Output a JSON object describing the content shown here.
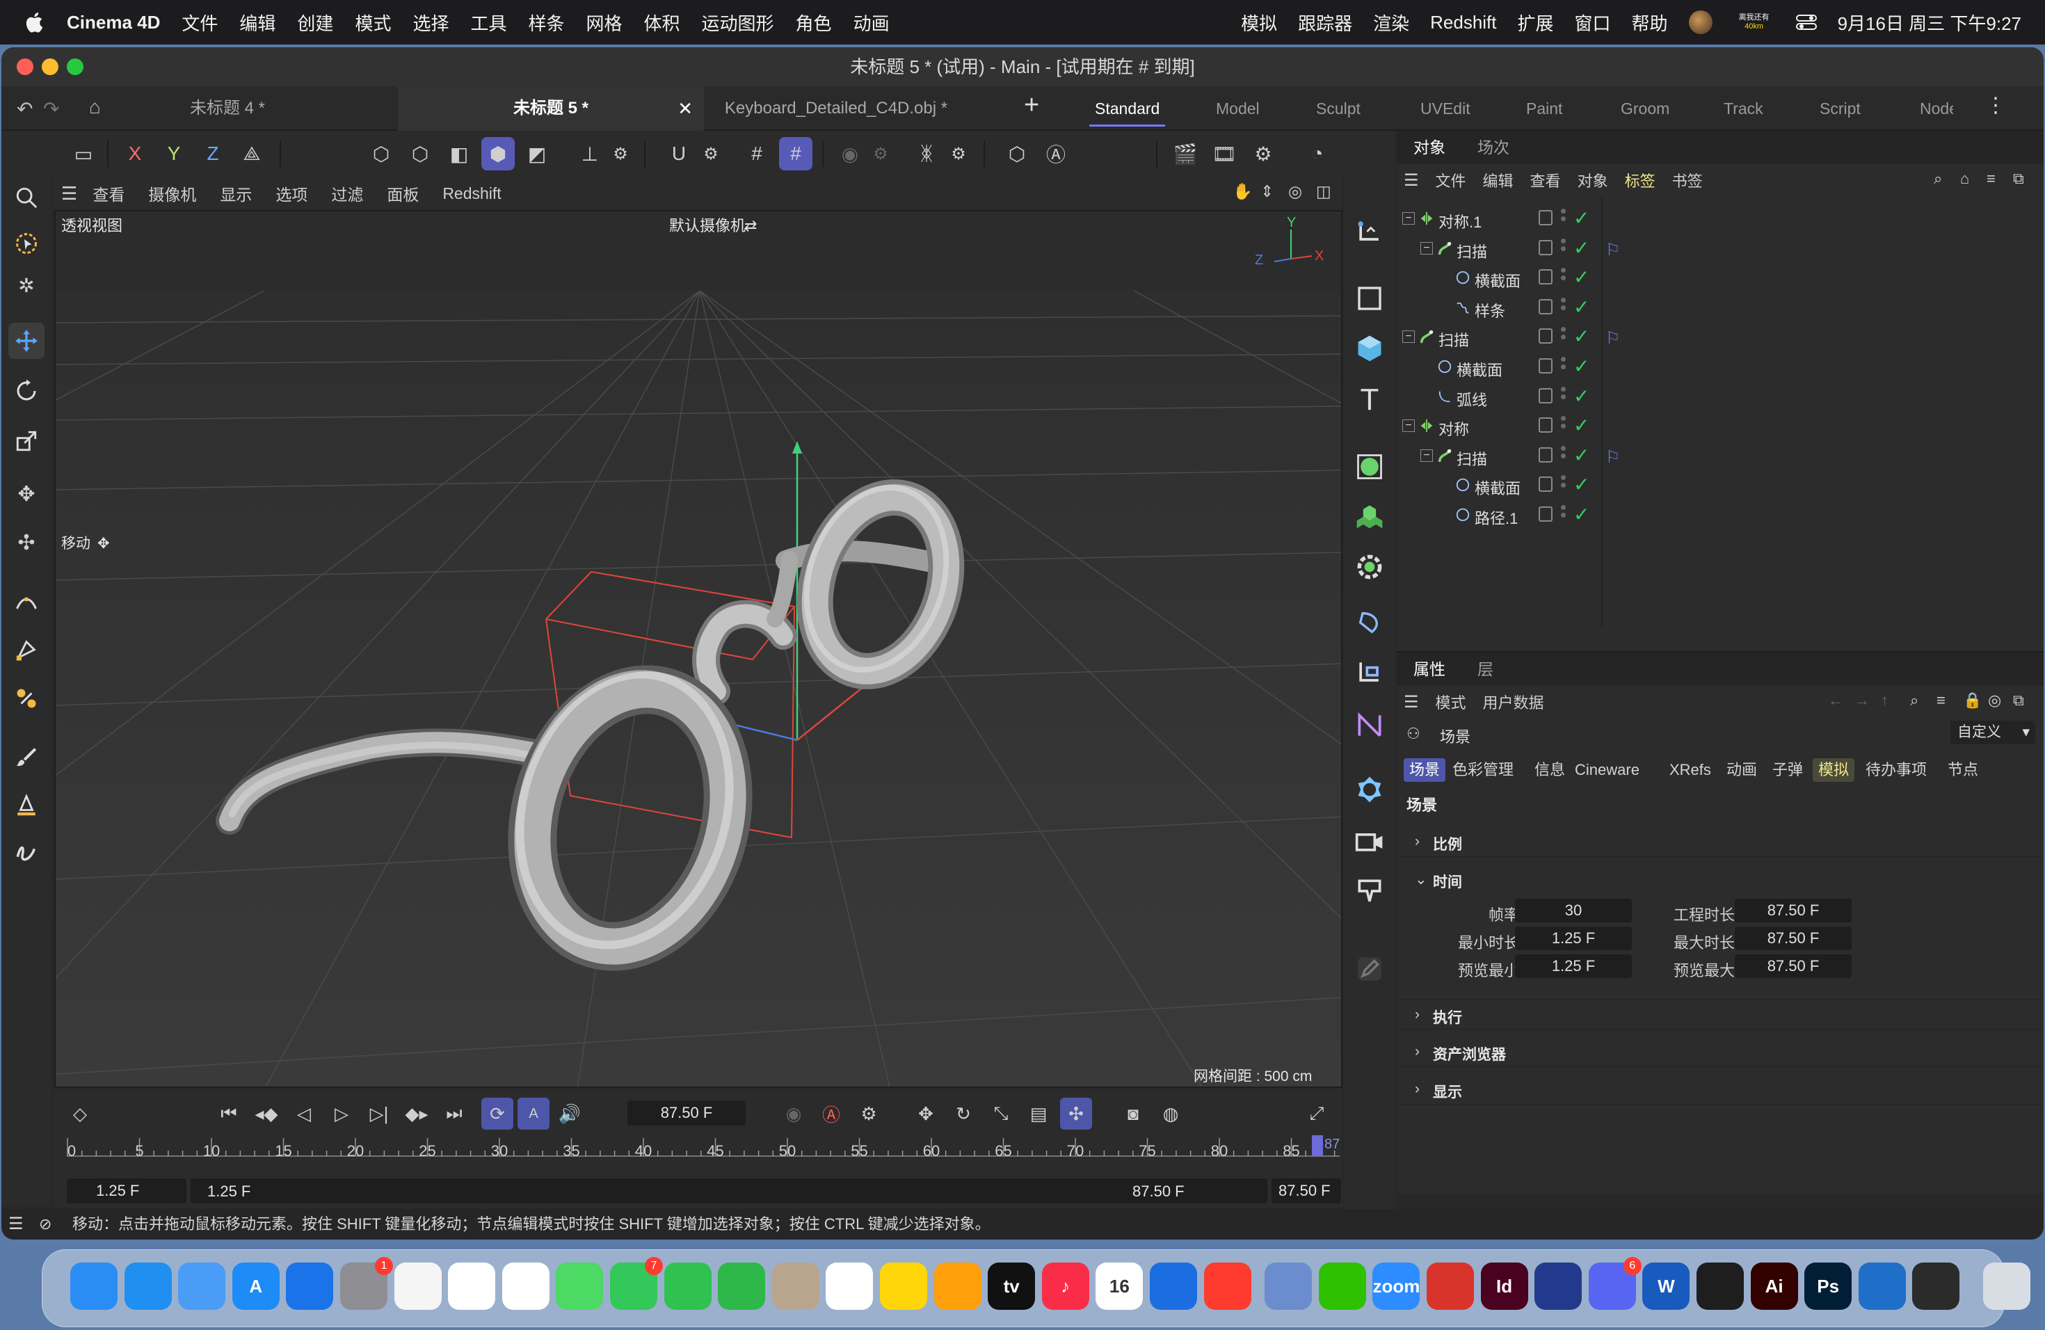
{
  "menubar": {
    "app": "Cinema 4D",
    "items": [
      "文件",
      "编辑",
      "创建",
      "模式",
      "选择",
      "工具",
      "样条",
      "网格",
      "体积",
      "运动图形",
      "角色",
      "动画"
    ],
    "right_items": [
      "模拟",
      "跟踪器",
      "渲染",
      "Redshift",
      "扩展",
      "窗口",
      "帮助"
    ],
    "status_text": "离我还有",
    "status_sub": "40km",
    "datetime": "9月16日 周三  下午9:27"
  },
  "window": {
    "title": "未标题 5 * (试用) - Main - [试用期在 # 到期]"
  },
  "doc_tabs": [
    "未标题 4 *",
    "未标题 5 *",
    "Keyboard_Detailed_C4D.obj *"
  ],
  "add_tab": "+",
  "layouts": [
    "Standard",
    "Model",
    "Sculpt",
    "UVEdit",
    "Paint",
    "Groom",
    "Track",
    "Script",
    "Node"
  ],
  "axes": {
    "x": "X",
    "y": "Y",
    "z": "Z"
  },
  "view_menu": [
    "查看",
    "摄像机",
    "显示",
    "选项",
    "过滤",
    "面板",
    "Redshift"
  ],
  "viewport": {
    "label": "透视视图",
    "camera": "默认摄像机",
    "tool_label": "移动",
    "grid_info": "网格间距 : 500 cm",
    "axis_y": "Y",
    "axis_x": "X",
    "axis_z": "Z"
  },
  "object_panel": {
    "tabs": [
      "对象",
      "场次"
    ],
    "menu": [
      "文件",
      "编辑",
      "查看",
      "对象",
      "标签",
      "书签"
    ],
    "rows": [
      {
        "name": "对称.1",
        "indent": 0,
        "type": "symmetry",
        "expand": "−",
        "tag": false
      },
      {
        "name": "扫描",
        "indent": 1,
        "type": "sweep",
        "expand": "−",
        "tag": true
      },
      {
        "name": "横截面",
        "indent": 2,
        "type": "circle",
        "expand": "",
        "tag": false
      },
      {
        "name": "样条",
        "indent": 2,
        "type": "spline",
        "expand": "",
        "tag": false
      },
      {
        "name": "扫描",
        "indent": 0,
        "type": "sweep",
        "expand": "−",
        "tag": true
      },
      {
        "name": "横截面",
        "indent": 1,
        "type": "circle",
        "expand": "",
        "tag": false
      },
      {
        "name": "弧线",
        "indent": 1,
        "type": "arc",
        "expand": "",
        "tag": false
      },
      {
        "name": "对称",
        "indent": 0,
        "type": "symmetry",
        "expand": "−",
        "tag": false
      },
      {
        "name": "扫描",
        "indent": 1,
        "type": "sweep",
        "expand": "−",
        "tag": true
      },
      {
        "name": "横截面",
        "indent": 2,
        "type": "circle",
        "expand": "",
        "tag": false
      },
      {
        "name": "路径.1",
        "indent": 2,
        "type": "circle",
        "expand": "",
        "tag": false
      }
    ]
  },
  "attr_panel": {
    "tabs": [
      "属性",
      "层"
    ],
    "menu": [
      "模式",
      "用户数据"
    ],
    "scene_label": "场景",
    "preset": "自定义",
    "chips": [
      "场景",
      "色彩管理",
      "信息",
      "Cineware",
      "XRefs",
      "动画",
      "子弹",
      "模拟",
      "待办事项",
      "节点"
    ],
    "heading": "场景",
    "sections": {
      "scale": "比例",
      "time": "时间",
      "exec": "执行",
      "asset": "资产浏览器",
      "display": "显示"
    },
    "fields": [
      {
        "label": "帧率",
        "value": "30"
      },
      {
        "label": "工程时长",
        "value": "87.50 F"
      },
      {
        "label": "最小时长",
        "value": "1.25 F"
      },
      {
        "label": "最大时长",
        "value": "87.50 F"
      },
      {
        "label": "预览最小",
        "value": "1.25 F"
      },
      {
        "label": "预览最大",
        "value": "87.50 F"
      }
    ]
  },
  "timeline": {
    "current_frame": "87.50 F",
    "ruler": [
      "0",
      "5",
      "10",
      "15",
      "20",
      "25",
      "30",
      "35",
      "40",
      "45",
      "50",
      "55",
      "60",
      "65",
      "70",
      "75",
      "80",
      "85"
    ],
    "playhead": "87",
    "range_start_a": "1.25 F",
    "range_start_b": "1.25 F",
    "range_end_a": "87.50 F",
    "range_end_b": "87.50 F"
  },
  "status": "移动：点击并拖动鼠标移动元素。按住 SHIFT 键量化移动；节点编辑模式时按住 SHIFT 键增加选择对象；按住 CTRL 键减少选择对象。",
  "dock": [
    {
      "name": "finder",
      "label": "",
      "color": "#2a8cf5"
    },
    {
      "name": "safari",
      "label": "",
      "color": "#1f8ff0"
    },
    {
      "name": "mail",
      "label": "",
      "color": "#4a9cf7"
    },
    {
      "name": "app-store",
      "label": "A",
      "color": "#1d8cf7"
    },
    {
      "name": "keynote",
      "label": "",
      "color": "#1a73e8"
    },
    {
      "name": "system-settings",
      "label": "",
      "color": "#8e8e93",
      "badge": "1"
    },
    {
      "name": "launchpad",
      "label": "",
      "color": "#f5f5f5"
    },
    {
      "name": "chrome",
      "label": "",
      "color": "#ffffff"
    },
    {
      "name": "photos",
      "label": "",
      "color": "#ffffff"
    },
    {
      "name": "maps",
      "label": "",
      "color": "#4cd964"
    },
    {
      "name": "messages",
      "label": "",
      "color": "#34c759",
      "badge": "7"
    },
    {
      "name": "facetime",
      "label": "",
      "color": "#2fc24f"
    },
    {
      "name": "numbers",
      "label": "",
      "color": "#2fb84a"
    },
    {
      "name": "contacts",
      "label": "",
      "color": "#b8a58e"
    },
    {
      "name": "reminders",
      "label": "",
      "color": "#ffffff"
    },
    {
      "name": "notes",
      "label": "",
      "color": "#ffd60a"
    },
    {
      "name": "pages",
      "label": "",
      "color": "#ff9f0a"
    },
    {
      "name": "apple-tv",
      "label": "tv",
      "color": "#111111"
    },
    {
      "name": "music",
      "label": "♪",
      "color": "#fa2d48"
    },
    {
      "name": "calendar",
      "label": "16",
      "color": "#ffffff"
    },
    {
      "name": "freeform",
      "label": "",
      "color": "#1b6ee0"
    },
    {
      "name": "news",
      "label": "",
      "color": "#ff3b30"
    },
    {
      "name": "finder-disk",
      "label": "",
      "color": "#6b8ccf"
    },
    {
      "name": "wechat",
      "label": "",
      "color": "#2dc100"
    },
    {
      "name": "zoom",
      "label": "zoom",
      "color": "#2d8cff"
    },
    {
      "name": "cinema4d-alt",
      "label": "",
      "color": "#d9342b"
    },
    {
      "name": "indesign",
      "label": "Id",
      "color": "#49021f"
    },
    {
      "name": "cinema4d",
      "label": "",
      "color": "#233a8c"
    },
    {
      "name": "discord",
      "label": "",
      "color": "#5865f2",
      "badge": "6"
    },
    {
      "name": "word",
      "label": "W",
      "color": "#185abd"
    },
    {
      "name": "figma",
      "label": "",
      "color": "#1e1e1e"
    },
    {
      "name": "illustrator",
      "label": "Ai",
      "color": "#330000"
    },
    {
      "name": "photoshop",
      "label": "Ps",
      "color": "#001e36"
    },
    {
      "name": "vscode",
      "label": "",
      "color": "#1f6fc9"
    },
    {
      "name": "blender",
      "label": "",
      "color": "#2b2b2b"
    },
    {
      "name": "trash",
      "label": "",
      "color": "#d8dde4"
    }
  ]
}
